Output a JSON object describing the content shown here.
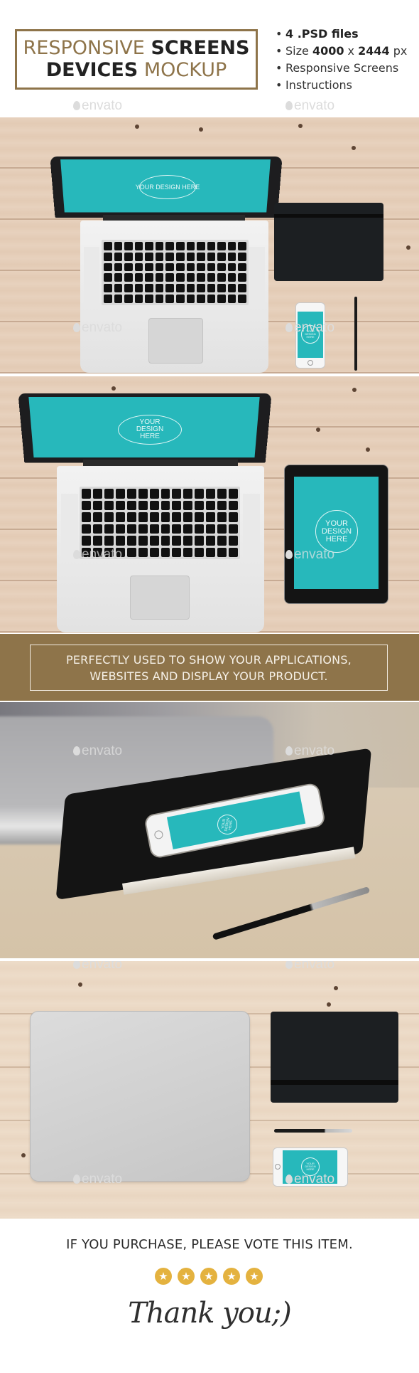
{
  "header": {
    "title": {
      "line1_light": "RESPONSIVE",
      "line1_bold": "SCREENS",
      "line2_bold": "DEVICES",
      "line2_light": "MOCKUP"
    },
    "features": [
      {
        "bullet": "•",
        "prefix": "",
        "bold": "4 .PSD files",
        "suffix": ""
      },
      {
        "bullet": "•",
        "prefix": "Size ",
        "bold": "4000",
        "mid": " x ",
        "bold2": "2444",
        "suffix": " px"
      },
      {
        "bullet": "•",
        "prefix": "Responsive Screens",
        "bold": "",
        "suffix": ""
      },
      {
        "bullet": "•",
        "prefix": "Instructions",
        "bold": "",
        "suffix": ""
      }
    ],
    "watermark": "envato"
  },
  "photos": [
    {
      "id": "desk-laptop-notebook-phone",
      "screen_text": [
        "YOUR",
        "DESIGN",
        "HERE"
      ],
      "watermark": "envato"
    },
    {
      "id": "desk-laptop-tablet",
      "screen_text": [
        "YOUR",
        "DESIGN",
        "HERE"
      ],
      "watermark": "envato"
    },
    {
      "id": "phone-on-notebook-perspective",
      "screen_text": [
        "YOUR",
        "DESIGN",
        "HERE"
      ],
      "watermark": "envato"
    },
    {
      "id": "closed-laptop-notebook-pen-phone",
      "screen_text": [
        "YOUR",
        "DESIGN",
        "HERE"
      ],
      "watermark": "envato"
    }
  ],
  "band": {
    "line1": "PERFECTLY USED TO SHOW YOUR APPLICATIONS,",
    "line2": "WEBSITES AND DISPLAY YOUR PRODUCT."
  },
  "footer": {
    "vote_text": "IF YOU PURCHASE, PLEASE VOTE THIS ITEM.",
    "rating": {
      "value": 5,
      "max": 5,
      "glyph": "★"
    },
    "thanks": "Thank you;)"
  },
  "colors": {
    "accent_gold": "#8e744a",
    "star_yellow": "#e4b23f",
    "screen_teal": "#27b8bb",
    "text_dark": "#222222"
  }
}
